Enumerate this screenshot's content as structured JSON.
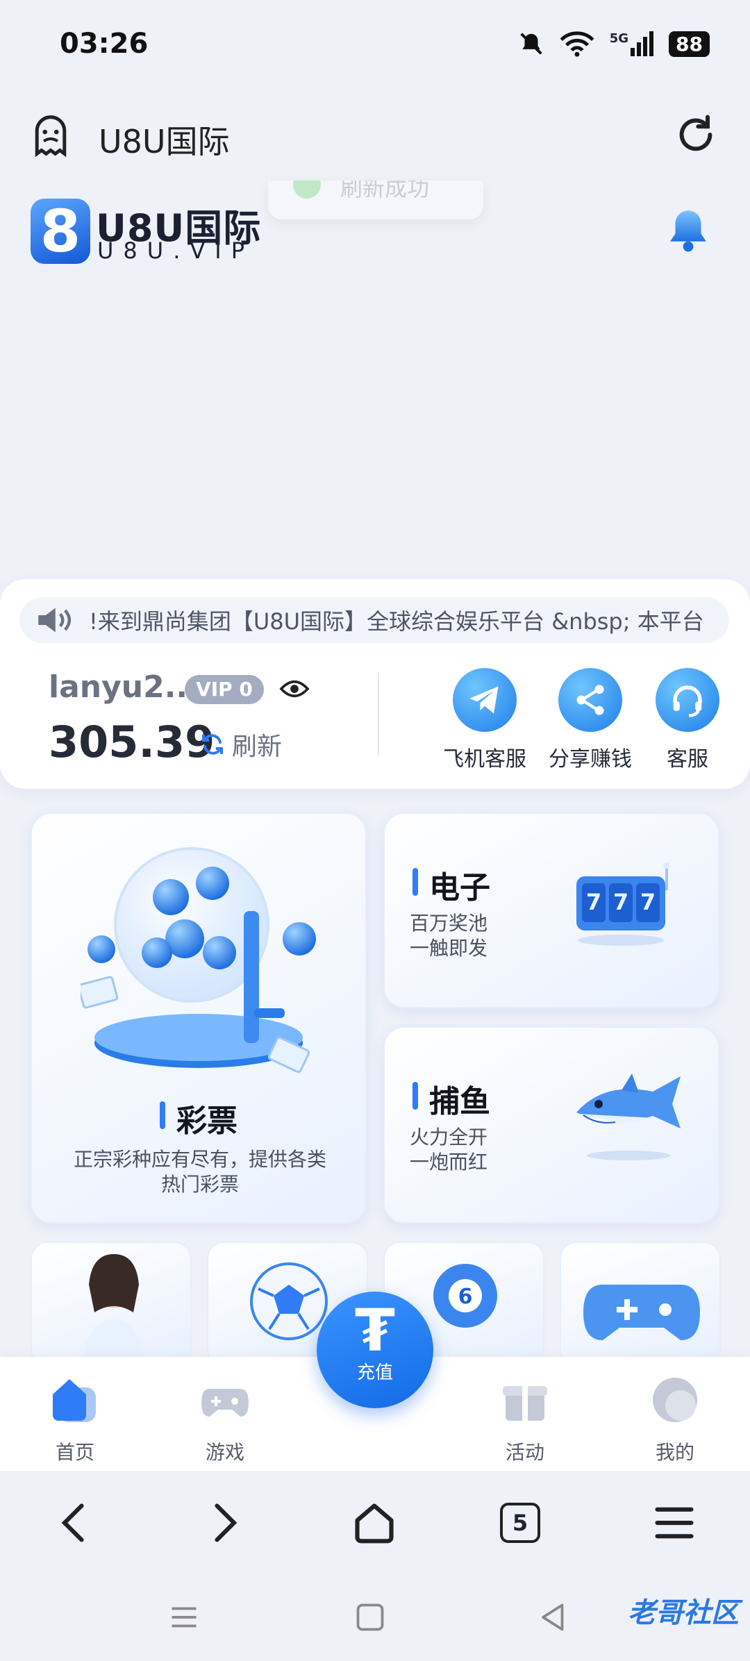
{
  "status": {
    "time": "03:26",
    "network": "5G",
    "battery": "88"
  },
  "browser": {
    "title": "U8U国际",
    "tab_count": "5"
  },
  "site": {
    "logo_mark": "8",
    "logo_title": "U8U国际",
    "logo_sub": "U8U.VIP",
    "toast_text": "刷新成功"
  },
  "marquee": {
    "text": "!来到鼎尚集团【U8U国际】全球综合娱乐平台 &nbsp; 本平台"
  },
  "account": {
    "username": "lanyu2...",
    "vip": "VIP 0",
    "balance": "305.39",
    "refresh_label": "刷新"
  },
  "quick_actions": [
    {
      "label": "飞机客服",
      "icon": "telegram-icon"
    },
    {
      "label": "分享赚钱",
      "icon": "share-icon"
    },
    {
      "label": "客服",
      "icon": "headset-icon"
    }
  ],
  "cards": {
    "lottery": {
      "title": "彩票",
      "desc": "正宗彩种应有尽有，提供各类热门彩票"
    },
    "electronic": {
      "title": "电子",
      "desc_line1": "百万奖池",
      "desc_line2": "一触即发"
    },
    "fishing": {
      "title": "捕鱼",
      "desc_line1": "火力全开",
      "desc_line2": "一炮而红"
    }
  },
  "bottom_nav": {
    "home": "首页",
    "games": "游戏",
    "recharge": "充值",
    "activity": "活动",
    "mine": "我的"
  },
  "watermark": "老哥社区",
  "colors": {
    "accent": "#2f7cf6",
    "background": "#eef1f8"
  }
}
